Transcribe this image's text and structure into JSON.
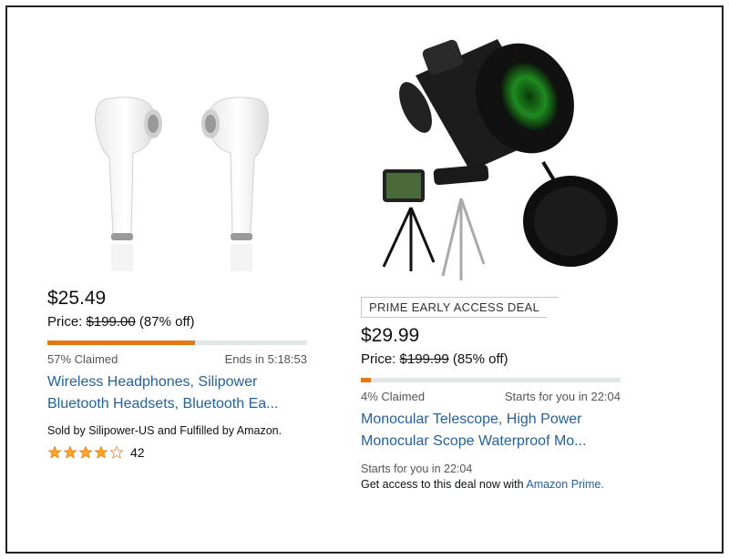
{
  "deals": [
    {
      "price": "$25.49",
      "price_label": "Price:",
      "list_price": "$199.00",
      "discount": "(87% off)",
      "claimed": "57% Claimed",
      "claimed_fraction": 0.57,
      "timer": "Ends in 5:18:53",
      "title_line1": "Wireless Headphones, Silipower",
      "title_line2": "Bluetooth Headsets, Bluetooth Ea...",
      "sold_by": "Sold by Silipower-US and Fulfilled by Amazon.",
      "rating_stars": 4.5,
      "rating_count": "42",
      "image_icon": "earbuds-icon"
    },
    {
      "badge": "PRIME EARLY ACCESS DEAL",
      "price": "$29.99",
      "price_label": "Price:",
      "list_price": "$199.99",
      "discount": "(85% off)",
      "claimed": "4% Claimed",
      "claimed_fraction": 0.04,
      "timer": "Starts for you in 22:04",
      "title_line1": "Monocular Telescope, High Power",
      "title_line2": "Monocular Scope Waterproof Mo...",
      "starts_note": "Starts for you in 22:04",
      "access_text": "Get access to this deal now with",
      "access_link": "Amazon Prime.",
      "image_icon": "monocular-icon"
    }
  ],
  "colors": {
    "link": "#2162a1",
    "progress": "#e47911",
    "track": "#e3e6e6",
    "star": "#ffa41c"
  }
}
